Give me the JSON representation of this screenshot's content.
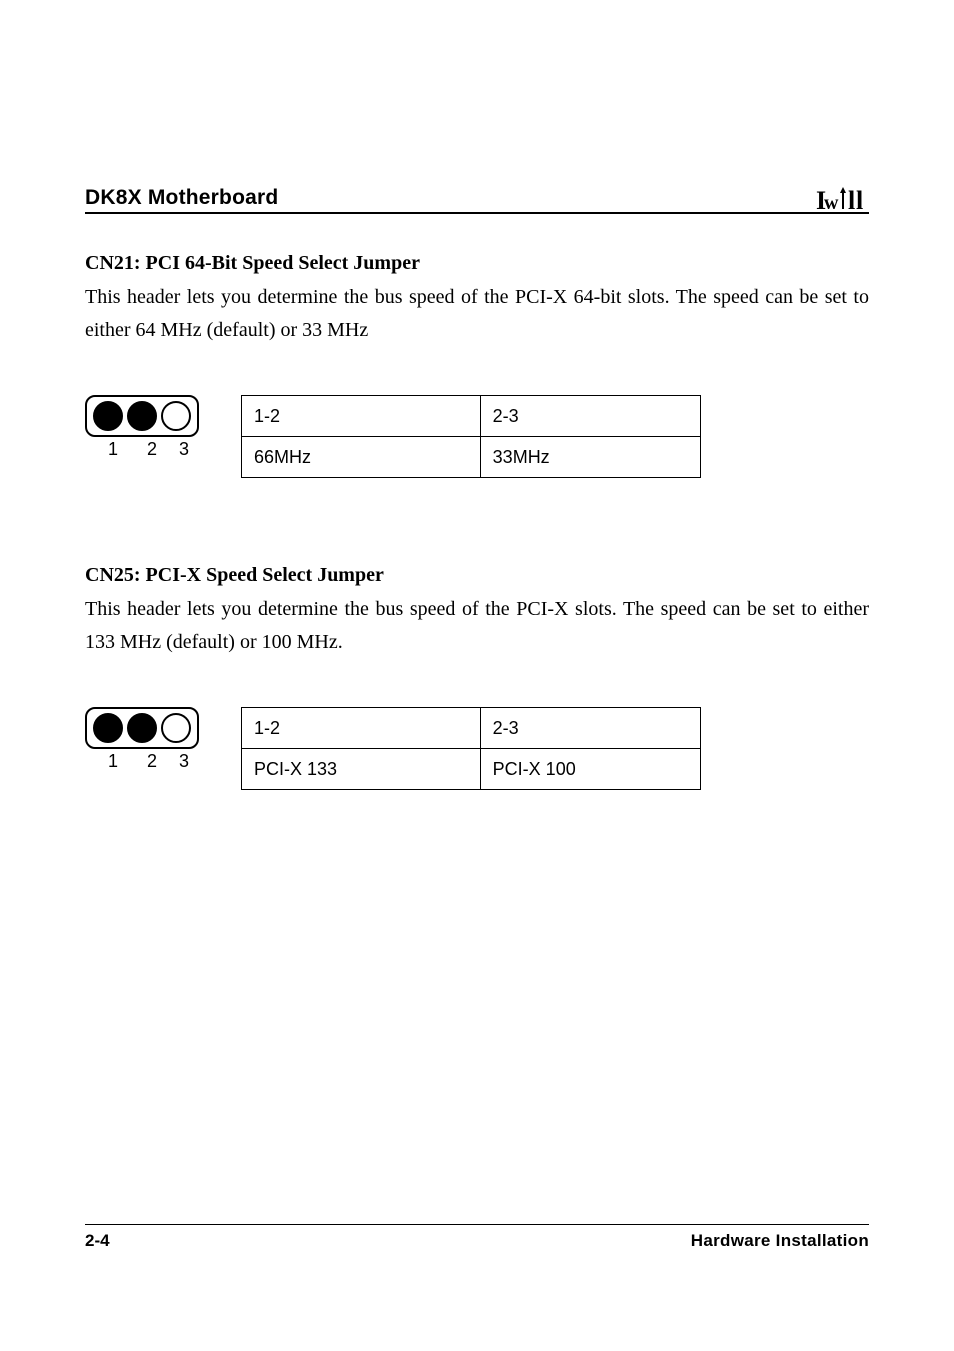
{
  "header": {
    "title": "DK8X Motherboard",
    "brand": "Iwill"
  },
  "sections": [
    {
      "heading": "CN21: PCI 64-Bit Speed Select Jumper",
      "body": "This header lets you determine the bus speed of the PCI-X 64-bit slots. The speed can be set to either 64 MHz (default) or 33 MHz",
      "pins": [
        "1",
        "2",
        "3"
      ],
      "table": {
        "r1c1": "1-2",
        "r1c2": "2-3",
        "r2c1": "66MHz",
        "r2c2": "33MHz"
      }
    },
    {
      "heading": "CN25: PCI-X Speed Select Jumper",
      "body": "This header lets you determine the bus speed of the PCI-X slots. The speed can be set to either 133 MHz (default) or 100 MHz.",
      "pins": [
        "1",
        "2",
        "3"
      ],
      "table": {
        "r1c1": "1-2",
        "r1c2": "2-3",
        "r2c1": "PCI-X 133",
        "r2c2": "PCI-X 100"
      }
    }
  ],
  "footer": {
    "page": "2-4",
    "section": "Hardware Installation"
  }
}
